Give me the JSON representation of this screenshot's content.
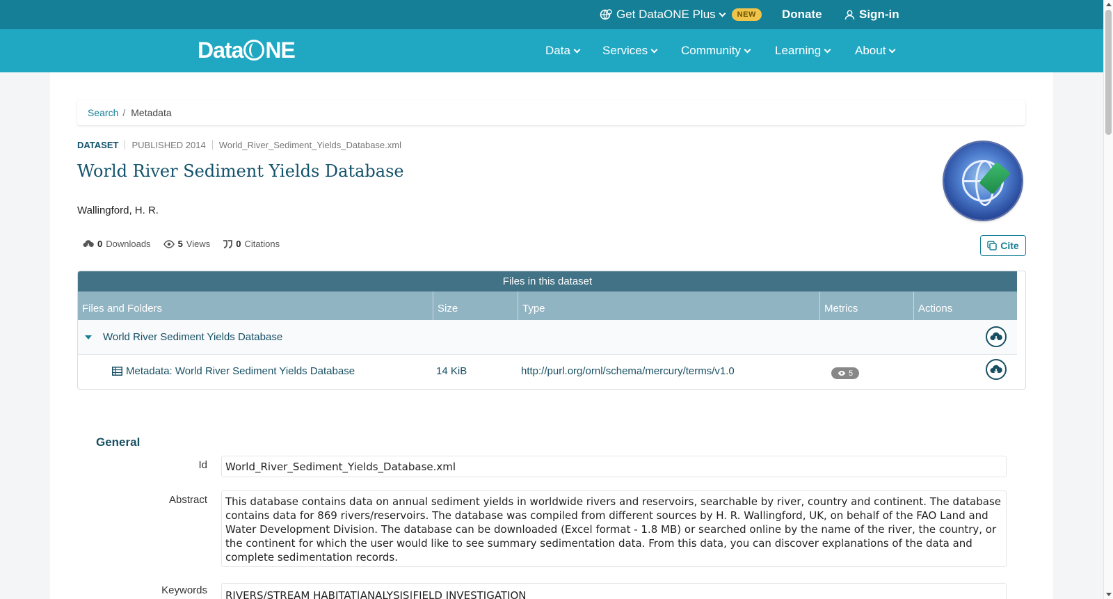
{
  "topbar": {
    "plus_label": "Get DataONE Plus",
    "new_badge": "NEW",
    "donate_label": "Donate",
    "signin_label": "Sign-in"
  },
  "nav": {
    "logo": {
      "prefix": "Data",
      "suffix": "NE"
    },
    "items": [
      {
        "label": "Data"
      },
      {
        "label": "Services"
      },
      {
        "label": "Community"
      },
      {
        "label": "Learning"
      },
      {
        "label": "About"
      }
    ]
  },
  "breadcrumb": {
    "search": "Search",
    "separator": "/",
    "current": "Metadata"
  },
  "dataset": {
    "type": "DATASET",
    "published": "PUBLISHED 2014",
    "identifier": "World_River_Sediment_Yields_Database.xml",
    "title": "World River Sediment Yields Database",
    "author": "Wallingford, H. R.",
    "metrics": {
      "downloads_count": "0",
      "downloads_label": "Downloads",
      "views_count": "5",
      "views_label": "Views",
      "citations_count": "0",
      "citations_label": "Citations"
    },
    "cite_label": "Cite"
  },
  "files": {
    "heading": "Files in this dataset",
    "columns": [
      "Files and Folders",
      "Size",
      "Type",
      "Metrics",
      "Actions"
    ],
    "folder": {
      "name": "World River Sediment Yields Database"
    },
    "items": [
      {
        "name": "Metadata: World River Sediment Yields Database",
        "size": "14 KiB",
        "type": "http://purl.org/ornl/schema/mercury/terms/v1.0",
        "views": "5"
      }
    ]
  },
  "general": {
    "heading": "General",
    "id_label": "Id",
    "id_value": "World_River_Sediment_Yields_Database.xml",
    "abstract_label": "Abstract",
    "abstract_value": "This database contains data on annual sediment yields in worldwide rivers and reservoirs, searchable by river, country and continent. The database contains data for 869 rivers/reservoirs. The database was compiled from different sources by H. R. Wallingford, UK, on behalf of the FAO Land and Water Development Division. The database can be downloaded (Excel format - 1.8 MB) or searched online by the name of the river, the country, or the continent for which the user would like to see summary sedimentation data. From this data, you can discover explanations of the data and complete sedimentation records.",
    "keywords_label": "Keywords",
    "keywords_value": "RIVERS/STREAM HABITAT|ANALYSIS|FIELD INVESTIGATION"
  },
  "colors": {
    "topbar": "#147f96",
    "navbar": "#20a8c3",
    "table_header": "#417285",
    "table_columns": "#91b4c2",
    "title": "#13526b"
  }
}
